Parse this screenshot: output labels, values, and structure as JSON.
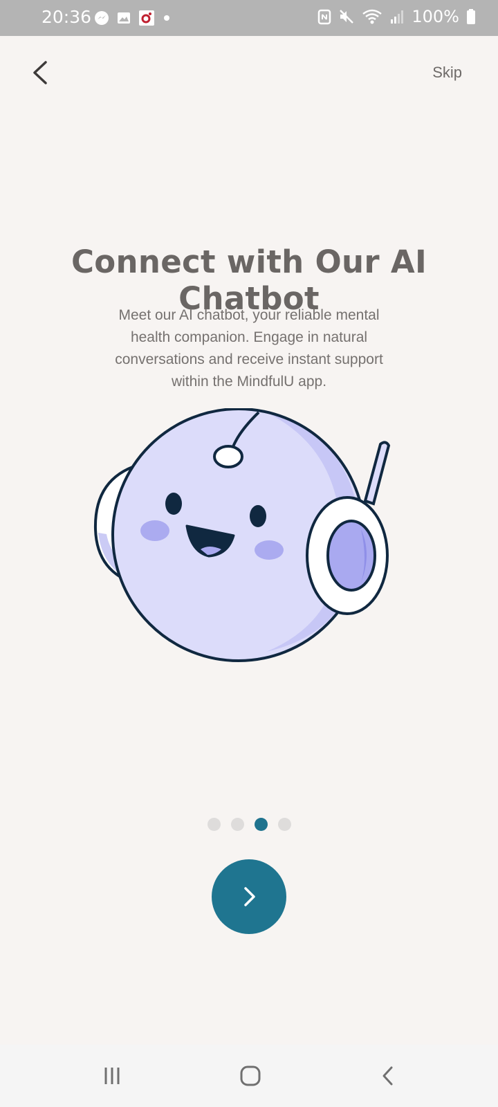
{
  "status_bar": {
    "time": "20:36",
    "battery": "100%",
    "notification_icons": [
      "messenger-icon",
      "gallery-icon",
      "app-notification-icon",
      "dot-icon"
    ],
    "status_icons": [
      "nfc-icon",
      "mute-icon",
      "wifi-icon",
      "signal-icon",
      "battery-icon"
    ]
  },
  "header": {
    "back_icon": "chevron-left-icon",
    "skip_label": "Skip"
  },
  "onboarding": {
    "title": "Connect with Our AI Chatbot",
    "description_lines": [
      "Meet our AI chatbot, your reliable mental",
      "health companion. Engage in natural",
      "conversations and receive instant support",
      "within the MindfulU app."
    ],
    "illustration": "robot-chatbot-mascot",
    "page_count": 4,
    "active_page": 3,
    "next_icon": "chevron-right-icon"
  },
  "colors": {
    "background": "#F7F4F2",
    "accent": "#1F7590",
    "title": "#6A6664",
    "mascot_body": "#DCDCFA",
    "mascot_outline": "#102840"
  },
  "system_nav": {
    "items": [
      "recents-icon",
      "home-icon",
      "back-icon"
    ]
  }
}
